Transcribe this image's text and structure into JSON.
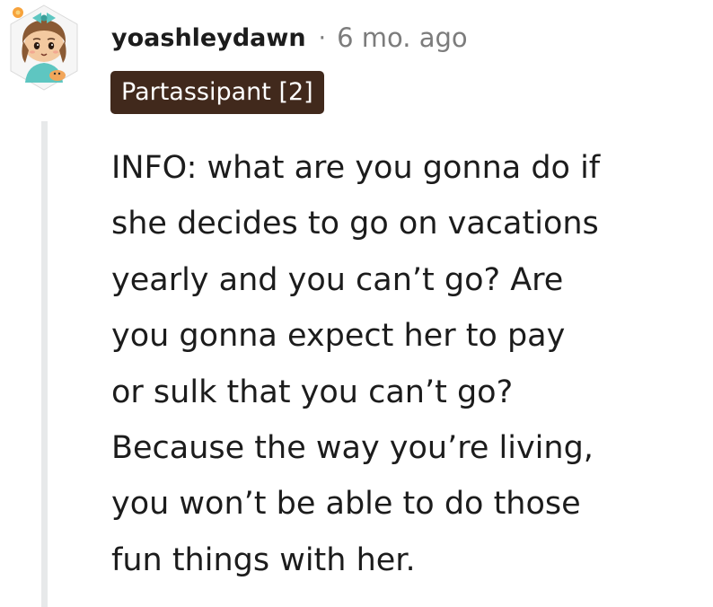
{
  "comment": {
    "username": "yoashleydawn",
    "separator": "·",
    "age": "6 mo. ago",
    "flair": "Partassipant [2]",
    "body_lines": [
      "INFO: what are you gonna do if",
      "she decides to go on vacations",
      "yearly and you can’t go? Are",
      "you gonna expect her to pay",
      "or sulk that you can’t go?",
      "Because the way you’re living,",
      "you won’t be able to do those",
      "fun things with her."
    ]
  },
  "colors": {
    "username": "#1c1c1c",
    "meta": "#7c7c7c",
    "flair_bg": "#41291c",
    "flair_text": "#ffffff",
    "thread_line": "#e7e9ea"
  },
  "icons": {
    "avatar": "snoo-avatar-icon"
  }
}
